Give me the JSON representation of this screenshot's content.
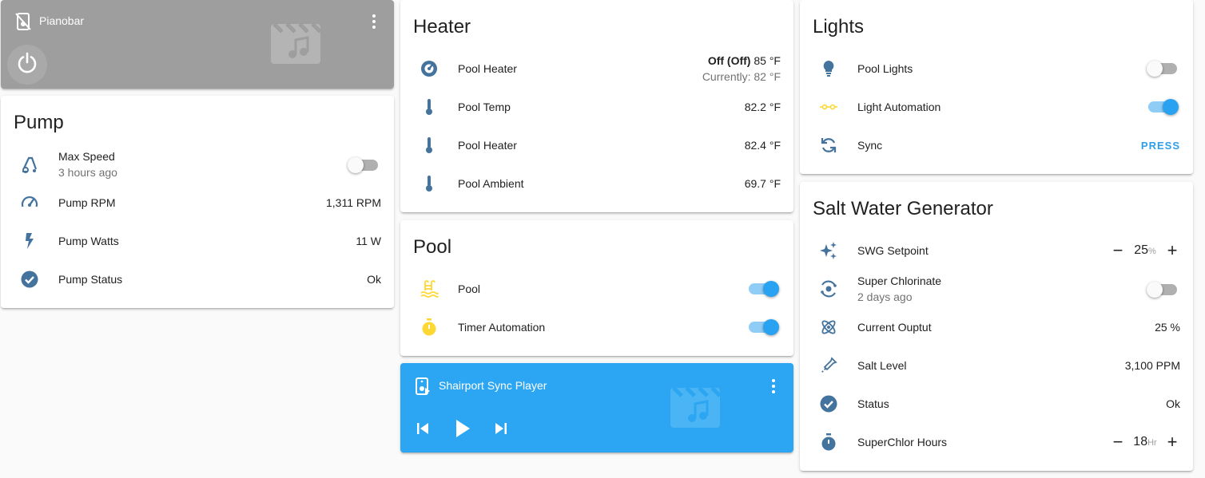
{
  "pianobar": {
    "title": "Pianobar",
    "header_icon": "speaker-off-icon",
    "power_icon": "power-icon",
    "art_icon": "movie-music-icon",
    "menu_icon": "more-vert-icon",
    "bg_color": "#9e9e9e"
  },
  "pump": {
    "title": "Pump",
    "rows": [
      {
        "icon": "vacuum-icon",
        "label": "Max Speed",
        "secondary": "3 hours ago",
        "toggle": false
      },
      {
        "icon": "gauge-icon",
        "label": "Pump RPM",
        "value": "1,311 RPM"
      },
      {
        "icon": "flash-icon",
        "label": "Pump Watts",
        "value": "11 W"
      },
      {
        "icon": "check-circle-icon",
        "label": "Pump Status",
        "value": "Ok"
      }
    ]
  },
  "heater": {
    "title": "Heater",
    "rows": [
      {
        "icon": "thermostat-icon",
        "label": "Pool Heater",
        "state": "Off (Off)",
        "target": "85 °F",
        "current": "Currently: 82 °F"
      },
      {
        "icon": "thermometer-icon",
        "label": "Pool Temp",
        "value": "82.2 °F"
      },
      {
        "icon": "thermometer-icon",
        "label": "Pool Heater",
        "value": "82.4 °F"
      },
      {
        "icon": "thermometer-icon",
        "label": "Pool Ambient",
        "value": "69.7 °F"
      }
    ]
  },
  "pool": {
    "title": "Pool",
    "rows": [
      {
        "icon": "pool-icon",
        "label": "Pool",
        "toggle": true
      },
      {
        "icon": "timer-icon",
        "label": "Timer Automation",
        "toggle": true
      }
    ]
  },
  "shairport": {
    "title": "Shairport Sync Player",
    "header_icon": "speaker-play-icon",
    "prev_icon": "skip-previous-icon",
    "play_icon": "play-icon",
    "next_icon": "skip-next-icon",
    "art_icon": "movie-music-icon",
    "menu_icon": "more-vert-icon",
    "bg_color": "#2ca6f2"
  },
  "lights": {
    "title": "Lights",
    "rows": [
      {
        "icon": "lightbulb-icon",
        "label": "Pool Lights",
        "toggle": false
      },
      {
        "icon": "automation-icon",
        "label": "Light Automation",
        "toggle": true
      },
      {
        "icon": "sync-icon",
        "label": "Sync",
        "action": "PRESS"
      }
    ]
  },
  "swg": {
    "title": "Salt Water Generator",
    "rows": [
      {
        "icon": "sparkles-icon",
        "label": "SWG Setpoint",
        "number": "25",
        "unit": "%"
      },
      {
        "icon": "atom-variant-icon",
        "label": "Super Chlorinate",
        "secondary": "2 days ago",
        "toggle": false
      },
      {
        "icon": "atom-icon",
        "label": "Current Ouptut",
        "value": "25 %"
      },
      {
        "icon": "eyedropper-icon",
        "label": "Salt Level",
        "value": "3,100 PPM"
      },
      {
        "icon": "check-circle-icon",
        "label": "Status",
        "value": "Ok"
      },
      {
        "icon": "timer-icon",
        "label": "SuperChlor Hours",
        "number": "18",
        "unit": "Hr"
      }
    ]
  },
  "colors": {
    "icon_blue": "#44739e",
    "icon_yellow": "#fdd835",
    "accent": "#29a3f1"
  }
}
